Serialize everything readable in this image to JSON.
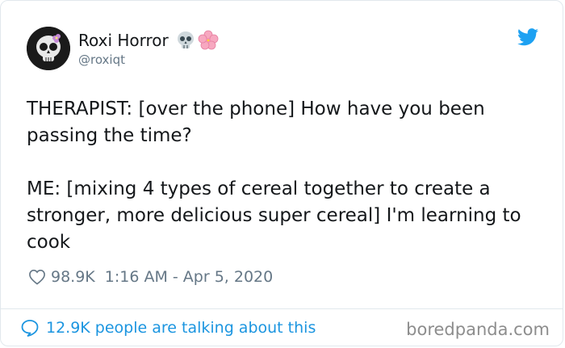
{
  "user": {
    "display_name": "Roxi Horror",
    "handle": "@roxiqt",
    "name_emoji": [
      "skull-emoji",
      "cherry-blossom-emoji"
    ]
  },
  "tweet": {
    "text": "THERAPIST: [over the phone] How have you been passing the time?\n\nME: [mixing 4 types of cereal together to create a stronger, more delicious super cereal] I'm learning to cook",
    "likes": "98.9K",
    "timestamp": "1:16 AM - Apr 5, 2020"
  },
  "footer": {
    "talking": "12.9K people are talking about this"
  },
  "watermark": "boredpanda.com",
  "colors": {
    "twitter_blue": "#1b95e0",
    "meta_gray": "#657786",
    "text": "#14171a"
  }
}
